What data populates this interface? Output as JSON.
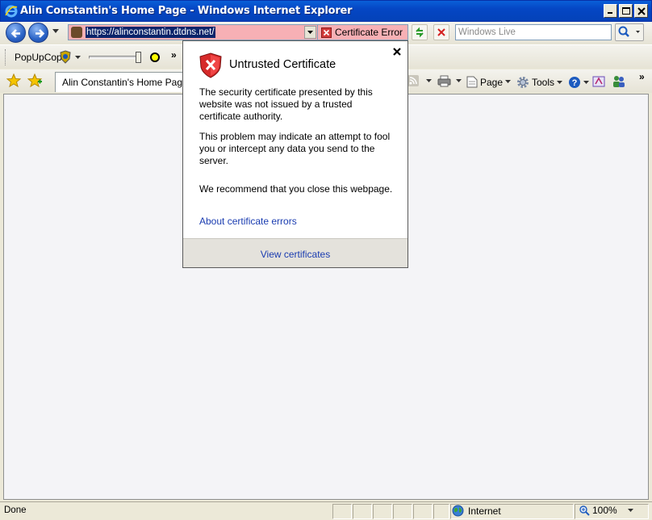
{
  "window": {
    "title": "Alin Constantin's Home Page - Windows Internet Explorer"
  },
  "address": {
    "url": "https://alinconstantin.dtdns.net/",
    "cert_error_label": "Certificate Error"
  },
  "search": {
    "placeholder": "Windows Live"
  },
  "toolbar": {
    "popupcop_label": "PopUpCop"
  },
  "tabs": [
    {
      "label": "Alin Constantin's Home Page"
    }
  ],
  "commands": {
    "page_label": "Page",
    "tools_label": "Tools"
  },
  "cert_popup": {
    "title": "Untrusted Certificate",
    "para1": "The security certificate presented by this website was not issued by a trusted certificate authority.",
    "para2": "This problem may indicate an attempt to fool you or intercept any data you send to the server.",
    "para3": "We recommend that you close this webpage.",
    "about_link": "About certificate errors",
    "view_link": "View certificates"
  },
  "statusbar": {
    "status": "Done",
    "zone": "Internet",
    "zoom": "100%"
  },
  "colors": {
    "error_bg": "#f7b0b5",
    "link": "#1a3cb0",
    "title_bar": "#0546c4"
  }
}
